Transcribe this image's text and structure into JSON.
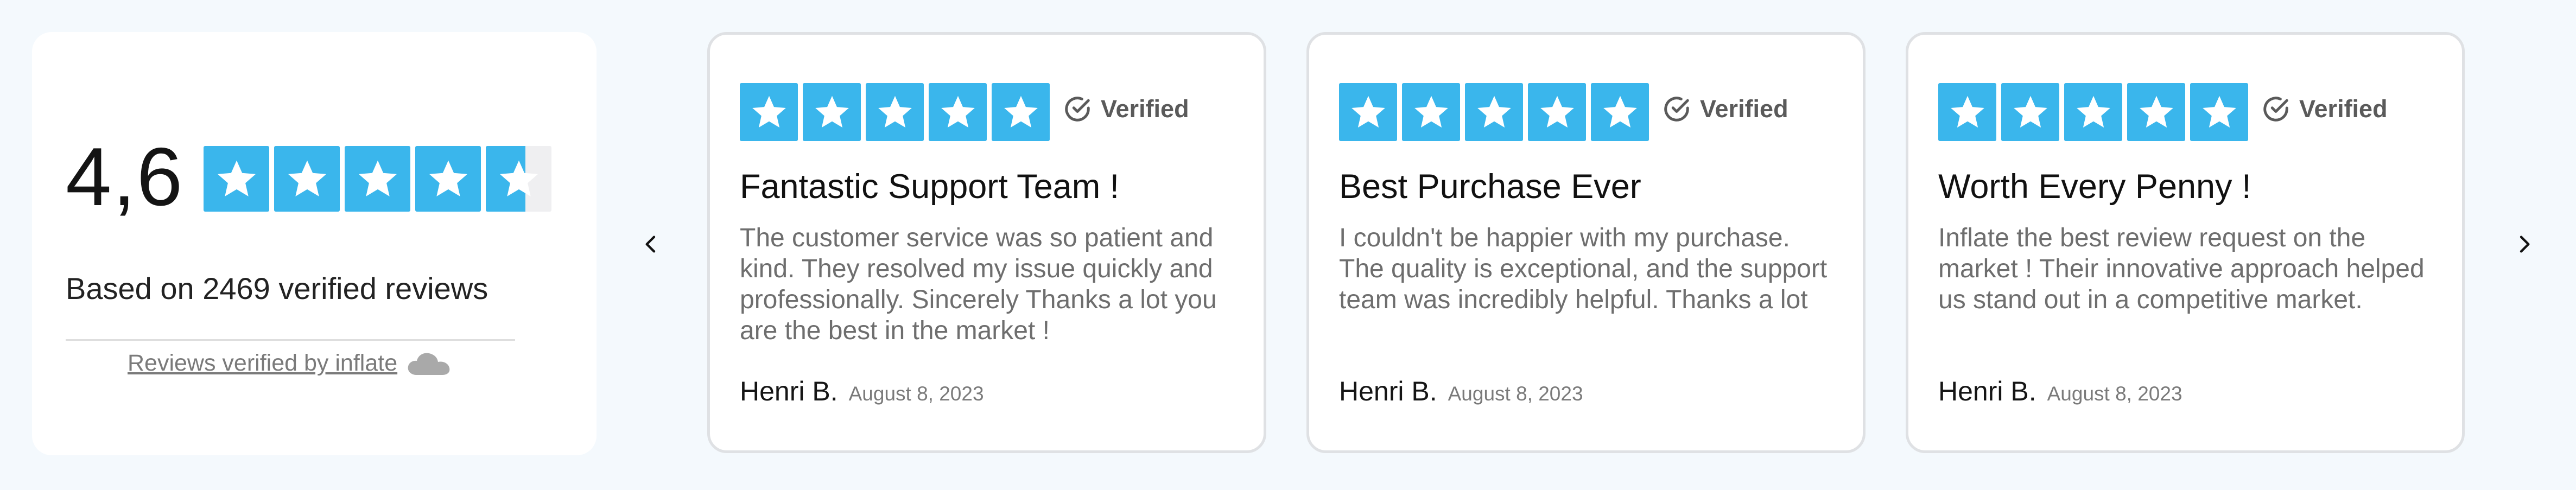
{
  "summary": {
    "score": "4,6",
    "rating": 4.6,
    "max_rating": 5,
    "based_on": "Based on 2469 verified reviews",
    "verified_by": "Reviews verified by inflate"
  },
  "colors": {
    "star": "#3ab6ec",
    "star_empty": "#efeff1",
    "background": "#f4f9fd",
    "card_border": "#dfe1e4"
  },
  "icons": {
    "prev": "chevron-left-icon",
    "next": "chevron-right-icon",
    "verified": "check-circle-icon",
    "brand": "cloud-icon"
  },
  "reviews": [
    {
      "rating": 5,
      "verified_label": "Verified",
      "title": "Fantastic Support Team !",
      "body": "The customer service was so patient and kind. They resolved my issue quickly and professionally. Sincerely Thanks a lot you are the best in the market !",
      "author": "Henri B.",
      "date": "August 8, 2023"
    },
    {
      "rating": 5,
      "verified_label": "Verified",
      "title": "Best Purchase Ever",
      "body": "I couldn't be happier with my purchase. The quality is exceptional, and the support team was incredibly helpful. Thanks a lot",
      "author": "Henri B.",
      "date": "August 8, 2023"
    },
    {
      "rating": 5,
      "verified_label": "Verified",
      "title": "Worth Every Penny !",
      "body": "Inflate the best review request on the market ! Their innovative approach helped us stand out in a competitive market.",
      "author": "Henri B.",
      "date": "August 8, 2023"
    }
  ]
}
